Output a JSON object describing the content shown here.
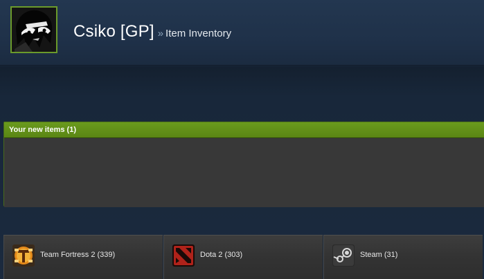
{
  "header": {
    "persona_name": "Csiko [GP]",
    "separator": "»",
    "subtitle": "Item Inventory"
  },
  "new_items": {
    "title": "Your new items (1)"
  },
  "game_tabs": [
    {
      "label": "Team Fortress 2 (339)",
      "icon": "team-fortress-2-icon"
    },
    {
      "label": "Dota 2 (303)",
      "icon": "dota-2-icon"
    },
    {
      "label": "Steam (31)",
      "icon": "steam-icon"
    }
  ],
  "colors": {
    "accent_green": "#5e8a17",
    "avatar_border": "#6b9b2b",
    "background": "#1b2838",
    "panel": "#383838"
  }
}
